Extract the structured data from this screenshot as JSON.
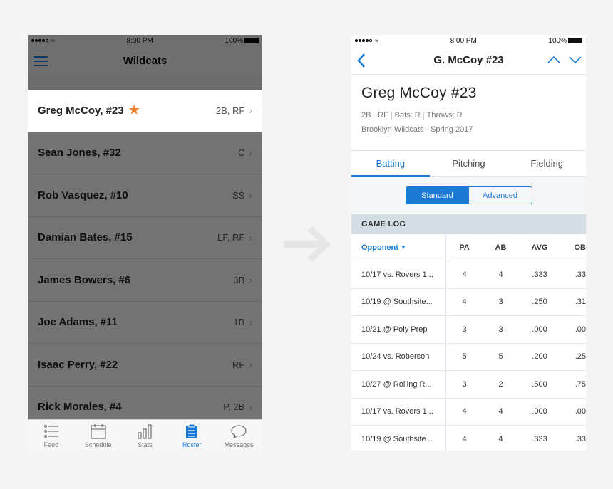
{
  "roster_screen": {
    "status": {
      "time": "8:00 PM",
      "battery": "100%"
    },
    "title": "Wildcats",
    "players": [
      {
        "name": "Greg McCoy, #23",
        "position": "2B, RF",
        "favorite": true
      },
      {
        "name": "Sean Jones, #32",
        "position": "C"
      },
      {
        "name": "Rob Vasquez, #10",
        "position": "SS"
      },
      {
        "name": "Damian Bates, #15",
        "position": "LF, RF"
      },
      {
        "name": "James Bowers, #6",
        "position": "3B"
      },
      {
        "name": "Joe Adams, #11",
        "position": "1B"
      },
      {
        "name": "Isaac Perry, #22",
        "position": "RF"
      },
      {
        "name": "Rick Morales, #4",
        "position": "P, 2B"
      }
    ],
    "tabbar": [
      {
        "label": "Feed",
        "icon": "feed-icon"
      },
      {
        "label": "Schedule",
        "icon": "calendar-icon"
      },
      {
        "label": "Stats",
        "icon": "bar-chart-icon"
      },
      {
        "label": "Roster",
        "icon": "clipboard-icon",
        "active": true
      },
      {
        "label": "Messages",
        "icon": "chat-bubble-icon"
      }
    ]
  },
  "player_screen": {
    "status": {
      "time": "8:00 PM",
      "battery": "100%"
    },
    "nav_title": "G. McCoy #23",
    "player_name": "Greg McCoy #23",
    "meta_line1": [
      "2B",
      "RF",
      "Bats: R",
      "Throws: R"
    ],
    "meta_line2": [
      "Brooklyn Wildcats",
      "Spring 2017"
    ],
    "stat_tabs": [
      "Batting",
      "Pitching",
      "Fielding"
    ],
    "active_stat_tab": "Batting",
    "segments": [
      "Standard",
      "Advanced"
    ],
    "active_segment": "Standard",
    "section_title": "GAME LOG",
    "columns": {
      "opponent": "Opponent",
      "pa": "PA",
      "ab": "AB",
      "avg": "AVG",
      "ob": "OB"
    },
    "games": [
      {
        "opponent": "10/17 vs. Rovers 1...",
        "pa": "4",
        "ab": "4",
        "avg": ".333",
        "ob": ".33"
      },
      {
        "opponent": "10/19 @ Southsite...",
        "pa": "4",
        "ab": "3",
        "avg": ".250",
        "ob": ".31"
      },
      {
        "opponent": "10/21 @ Poly Prep",
        "pa": "3",
        "ab": "3",
        "avg": ".000",
        "ob": ".00"
      },
      {
        "opponent": "10/24 vs. Roberson",
        "pa": "5",
        "ab": "5",
        "avg": ".200",
        "ob": ".25"
      },
      {
        "opponent": "10/27 @ Rolling R...",
        "pa": "3",
        "ab": "2",
        "avg": ".500",
        "ob": ".75"
      },
      {
        "opponent": "10/17 vs. Rovers 1...",
        "pa": "4",
        "ab": "4",
        "avg": ".000",
        "ob": ".00"
      },
      {
        "opponent": "10/19 @ Southsite...",
        "pa": "4",
        "ab": "4",
        "avg": ".333",
        "ob": ".33"
      }
    ]
  },
  "colors": {
    "accent": "#1a7ad4",
    "star": "#f0802a",
    "section": "#d3dde4"
  }
}
